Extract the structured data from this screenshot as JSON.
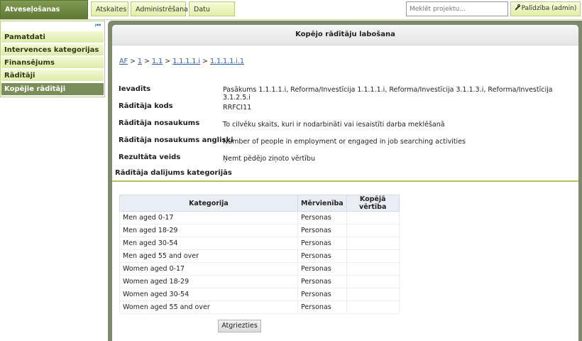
{
  "topnav": {
    "tabs": [
      {
        "label": "Atveseļošanas mehānisms",
        "active": true
      },
      {
        "label": "Atskaites"
      },
      {
        "label": "Administrēšana"
      },
      {
        "label": "Datu analīze"
      }
    ],
    "search_placeholder": "Meklēt projektu...",
    "help_label": "Palīdzība (admin)"
  },
  "sidebar": {
    "items": [
      {
        "label": "Pamatdati"
      },
      {
        "label": "Intervences kategorijas"
      },
      {
        "label": "Finansējums"
      },
      {
        "label": "Rādītāji"
      },
      {
        "label": "Kopējie rādītāji",
        "active": true
      }
    ]
  },
  "page": {
    "title": "Kopējo rādītāju labošana",
    "breadcrumb": [
      "AF",
      "1",
      "1.1",
      "1.1.1.1.i",
      "1.1.1.1.i.1"
    ],
    "fields": [
      {
        "label": "Ievadīts",
        "value": "Pasākums 1.1.1.1.i, Reforma/Investīcija 1.1.1.1.i, Reforma/Investīcija 3.1.1.3.i, Reforma/Investīcija 3.1.2.5.i"
      },
      {
        "label": "Rādītāja kods",
        "value": "RRFCI11"
      },
      {
        "label": "Rādītāja nosaukums",
        "value": "To cilvēku skaits, kuri ir nodarbināti vai iesaistīti darba meklēšanā"
      },
      {
        "label": "Rādītāja nosaukums angliski",
        "value": "Number of people in employment or engaged in job searching activities"
      },
      {
        "label": "Rezultāta veids",
        "value": "Ņemt pēdējo ziņoto vērtību"
      }
    ],
    "section_title": "Rādītāja dalījums kategorijās",
    "table": {
      "headers": [
        "Kategorija",
        "Mērvienība",
        "Kopējā vērtība"
      ],
      "rows": [
        [
          "Men aged 0-17",
          "Personas",
          ""
        ],
        [
          "Men aged 18-29",
          "Personas",
          ""
        ],
        [
          "Men aged 30-54",
          "Personas",
          ""
        ],
        [
          "Men aged 55 and over",
          "Personas",
          ""
        ],
        [
          "Women aged 0-17",
          "Personas",
          ""
        ],
        [
          "Women aged 18-29",
          "Personas",
          ""
        ],
        [
          "Women aged 30-54",
          "Personas",
          ""
        ],
        [
          "Women aged 55 and over",
          "Personas",
          ""
        ]
      ]
    },
    "back_label": "Atgriezties"
  }
}
